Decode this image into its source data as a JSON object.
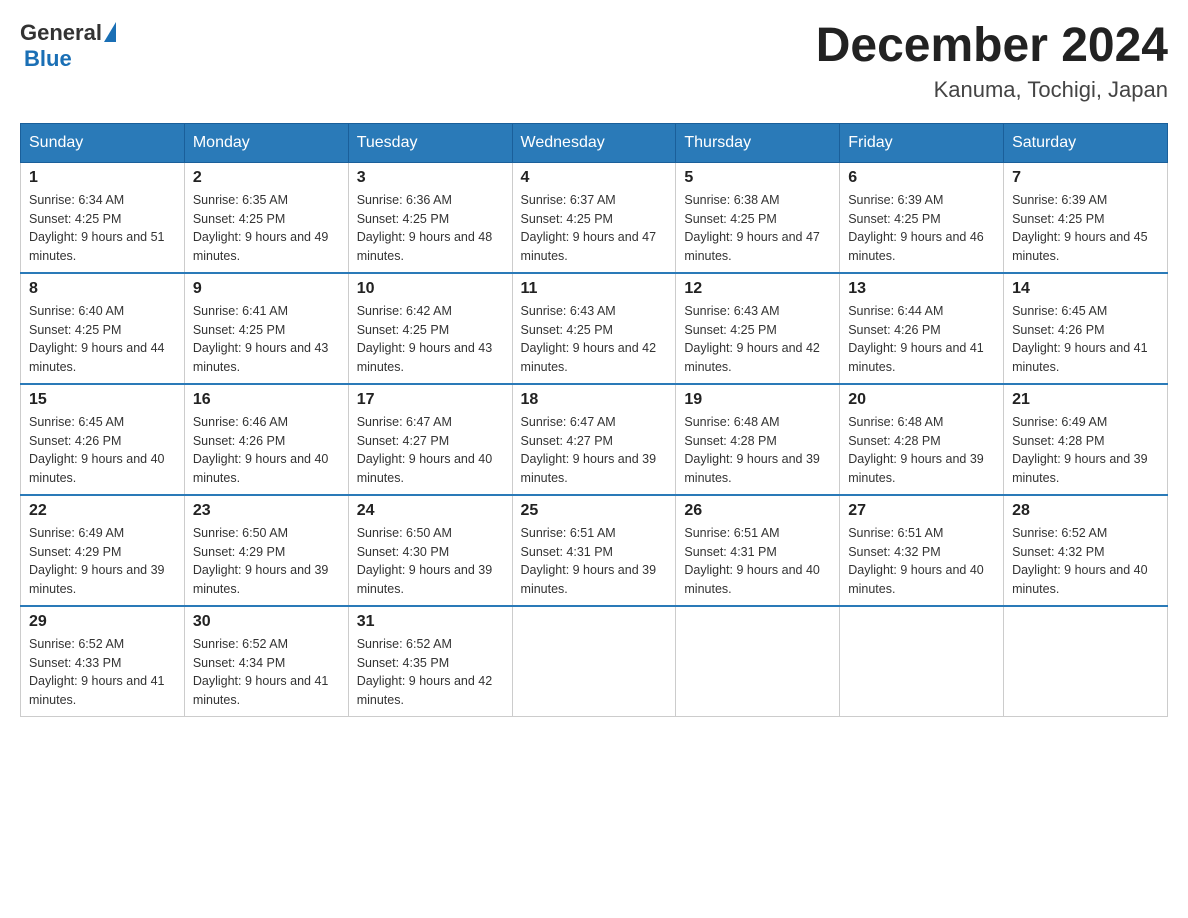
{
  "header": {
    "logo_general": "General",
    "logo_blue": "Blue",
    "title": "December 2024",
    "location": "Kanuma, Tochigi, Japan"
  },
  "days_of_week": [
    "Sunday",
    "Monday",
    "Tuesday",
    "Wednesday",
    "Thursday",
    "Friday",
    "Saturday"
  ],
  "weeks": [
    [
      {
        "day": "1",
        "sunrise": "6:34 AM",
        "sunset": "4:25 PM",
        "daylight": "9 hours and 51 minutes."
      },
      {
        "day": "2",
        "sunrise": "6:35 AM",
        "sunset": "4:25 PM",
        "daylight": "9 hours and 49 minutes."
      },
      {
        "day": "3",
        "sunrise": "6:36 AM",
        "sunset": "4:25 PM",
        "daylight": "9 hours and 48 minutes."
      },
      {
        "day": "4",
        "sunrise": "6:37 AM",
        "sunset": "4:25 PM",
        "daylight": "9 hours and 47 minutes."
      },
      {
        "day": "5",
        "sunrise": "6:38 AM",
        "sunset": "4:25 PM",
        "daylight": "9 hours and 47 minutes."
      },
      {
        "day": "6",
        "sunrise": "6:39 AM",
        "sunset": "4:25 PM",
        "daylight": "9 hours and 46 minutes."
      },
      {
        "day": "7",
        "sunrise": "6:39 AM",
        "sunset": "4:25 PM",
        "daylight": "9 hours and 45 minutes."
      }
    ],
    [
      {
        "day": "8",
        "sunrise": "6:40 AM",
        "sunset": "4:25 PM",
        "daylight": "9 hours and 44 minutes."
      },
      {
        "day": "9",
        "sunrise": "6:41 AM",
        "sunset": "4:25 PM",
        "daylight": "9 hours and 43 minutes."
      },
      {
        "day": "10",
        "sunrise": "6:42 AM",
        "sunset": "4:25 PM",
        "daylight": "9 hours and 43 minutes."
      },
      {
        "day": "11",
        "sunrise": "6:43 AM",
        "sunset": "4:25 PM",
        "daylight": "9 hours and 42 minutes."
      },
      {
        "day": "12",
        "sunrise": "6:43 AM",
        "sunset": "4:25 PM",
        "daylight": "9 hours and 42 minutes."
      },
      {
        "day": "13",
        "sunrise": "6:44 AM",
        "sunset": "4:26 PM",
        "daylight": "9 hours and 41 minutes."
      },
      {
        "day": "14",
        "sunrise": "6:45 AM",
        "sunset": "4:26 PM",
        "daylight": "9 hours and 41 minutes."
      }
    ],
    [
      {
        "day": "15",
        "sunrise": "6:45 AM",
        "sunset": "4:26 PM",
        "daylight": "9 hours and 40 minutes."
      },
      {
        "day": "16",
        "sunrise": "6:46 AM",
        "sunset": "4:26 PM",
        "daylight": "9 hours and 40 minutes."
      },
      {
        "day": "17",
        "sunrise": "6:47 AM",
        "sunset": "4:27 PM",
        "daylight": "9 hours and 40 minutes."
      },
      {
        "day": "18",
        "sunrise": "6:47 AM",
        "sunset": "4:27 PM",
        "daylight": "9 hours and 39 minutes."
      },
      {
        "day": "19",
        "sunrise": "6:48 AM",
        "sunset": "4:28 PM",
        "daylight": "9 hours and 39 minutes."
      },
      {
        "day": "20",
        "sunrise": "6:48 AM",
        "sunset": "4:28 PM",
        "daylight": "9 hours and 39 minutes."
      },
      {
        "day": "21",
        "sunrise": "6:49 AM",
        "sunset": "4:28 PM",
        "daylight": "9 hours and 39 minutes."
      }
    ],
    [
      {
        "day": "22",
        "sunrise": "6:49 AM",
        "sunset": "4:29 PM",
        "daylight": "9 hours and 39 minutes."
      },
      {
        "day": "23",
        "sunrise": "6:50 AM",
        "sunset": "4:29 PM",
        "daylight": "9 hours and 39 minutes."
      },
      {
        "day": "24",
        "sunrise": "6:50 AM",
        "sunset": "4:30 PM",
        "daylight": "9 hours and 39 minutes."
      },
      {
        "day": "25",
        "sunrise": "6:51 AM",
        "sunset": "4:31 PM",
        "daylight": "9 hours and 39 minutes."
      },
      {
        "day": "26",
        "sunrise": "6:51 AM",
        "sunset": "4:31 PM",
        "daylight": "9 hours and 40 minutes."
      },
      {
        "day": "27",
        "sunrise": "6:51 AM",
        "sunset": "4:32 PM",
        "daylight": "9 hours and 40 minutes."
      },
      {
        "day": "28",
        "sunrise": "6:52 AM",
        "sunset": "4:32 PM",
        "daylight": "9 hours and 40 minutes."
      }
    ],
    [
      {
        "day": "29",
        "sunrise": "6:52 AM",
        "sunset": "4:33 PM",
        "daylight": "9 hours and 41 minutes."
      },
      {
        "day": "30",
        "sunrise": "6:52 AM",
        "sunset": "4:34 PM",
        "daylight": "9 hours and 41 minutes."
      },
      {
        "day": "31",
        "sunrise": "6:52 AM",
        "sunset": "4:35 PM",
        "daylight": "9 hours and 42 minutes."
      },
      null,
      null,
      null,
      null
    ]
  ]
}
